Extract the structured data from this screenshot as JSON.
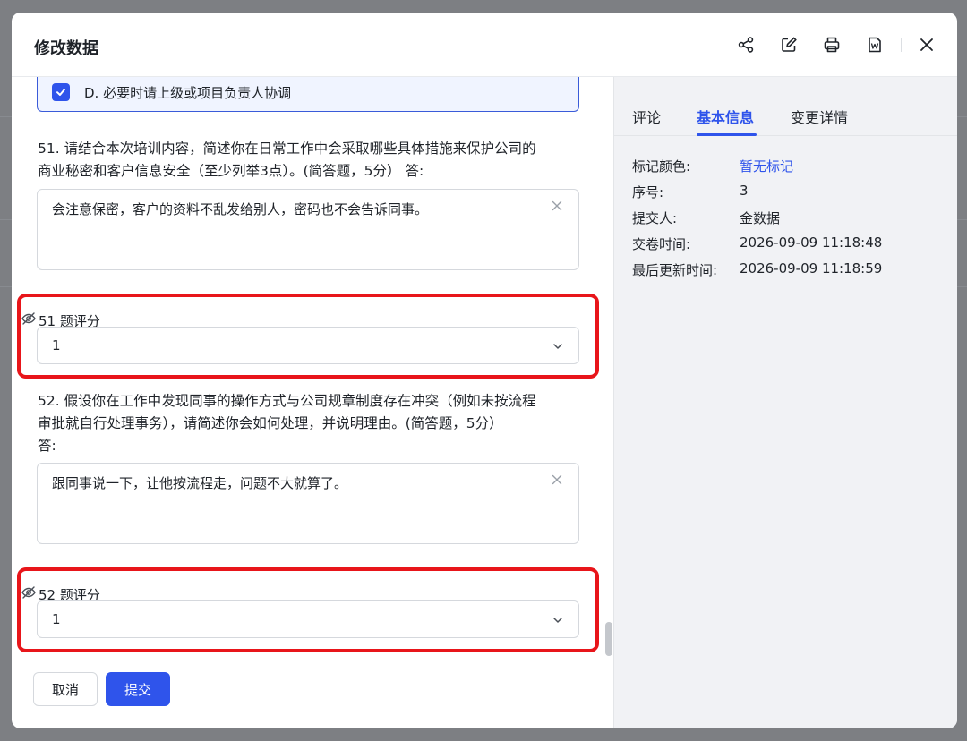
{
  "modal": {
    "title": "修改数据",
    "header_icons": [
      "share-icon",
      "edit-icon",
      "print-icon",
      "word-export-icon",
      "close-icon"
    ]
  },
  "form": {
    "prev_option": {
      "label": "D. 必要时请上级或项目负责人协调",
      "checked": true
    },
    "q51": {
      "line1": "51. 请结合本次培训内容，简述你在日常工作中会采取哪些具体措施来保护公司的",
      "line2": "商业秘密和客户信息安全（至少列举3点）。(简答题，5分） 答:",
      "answer": "会注意保密，客户的资料不乱发给别人，密码也不会告诉同事。",
      "score_label": "51 题评分",
      "score_value": "1"
    },
    "q52": {
      "line1": "52. 假设你在工作中发现同事的操作方式与公司规章制度存在冲突（例如未按流程",
      "line2": "审批就自行处理事务），请简述你会如何处理，并说明理由。(简答题，5分）",
      "line3": "答:",
      "answer": "跟同事说一下，让他按流程走，问题不大就算了。",
      "score_label": "52 题评分",
      "score_value": "1"
    },
    "cancel_label": "取消",
    "submit_label": "提交"
  },
  "sidebar": {
    "tabs": [
      {
        "label": "评论",
        "active": false
      },
      {
        "label": "基本信息",
        "active": true
      },
      {
        "label": "变更详情",
        "active": false
      }
    ],
    "info": [
      {
        "key": "标记颜色:",
        "value": "暂无标记"
      },
      {
        "key": "序号:",
        "value": "3"
      },
      {
        "key": "提交人:",
        "value": "金数据"
      },
      {
        "key": "交卷时间:",
        "value": "2026-09-09 11:18:48"
      },
      {
        "key": "最后更新时间:",
        "value": "2026-09-09 11:18:59"
      }
    ]
  },
  "colors": {
    "accent": "#2f54eb",
    "highlight_box": "#e8151a"
  }
}
